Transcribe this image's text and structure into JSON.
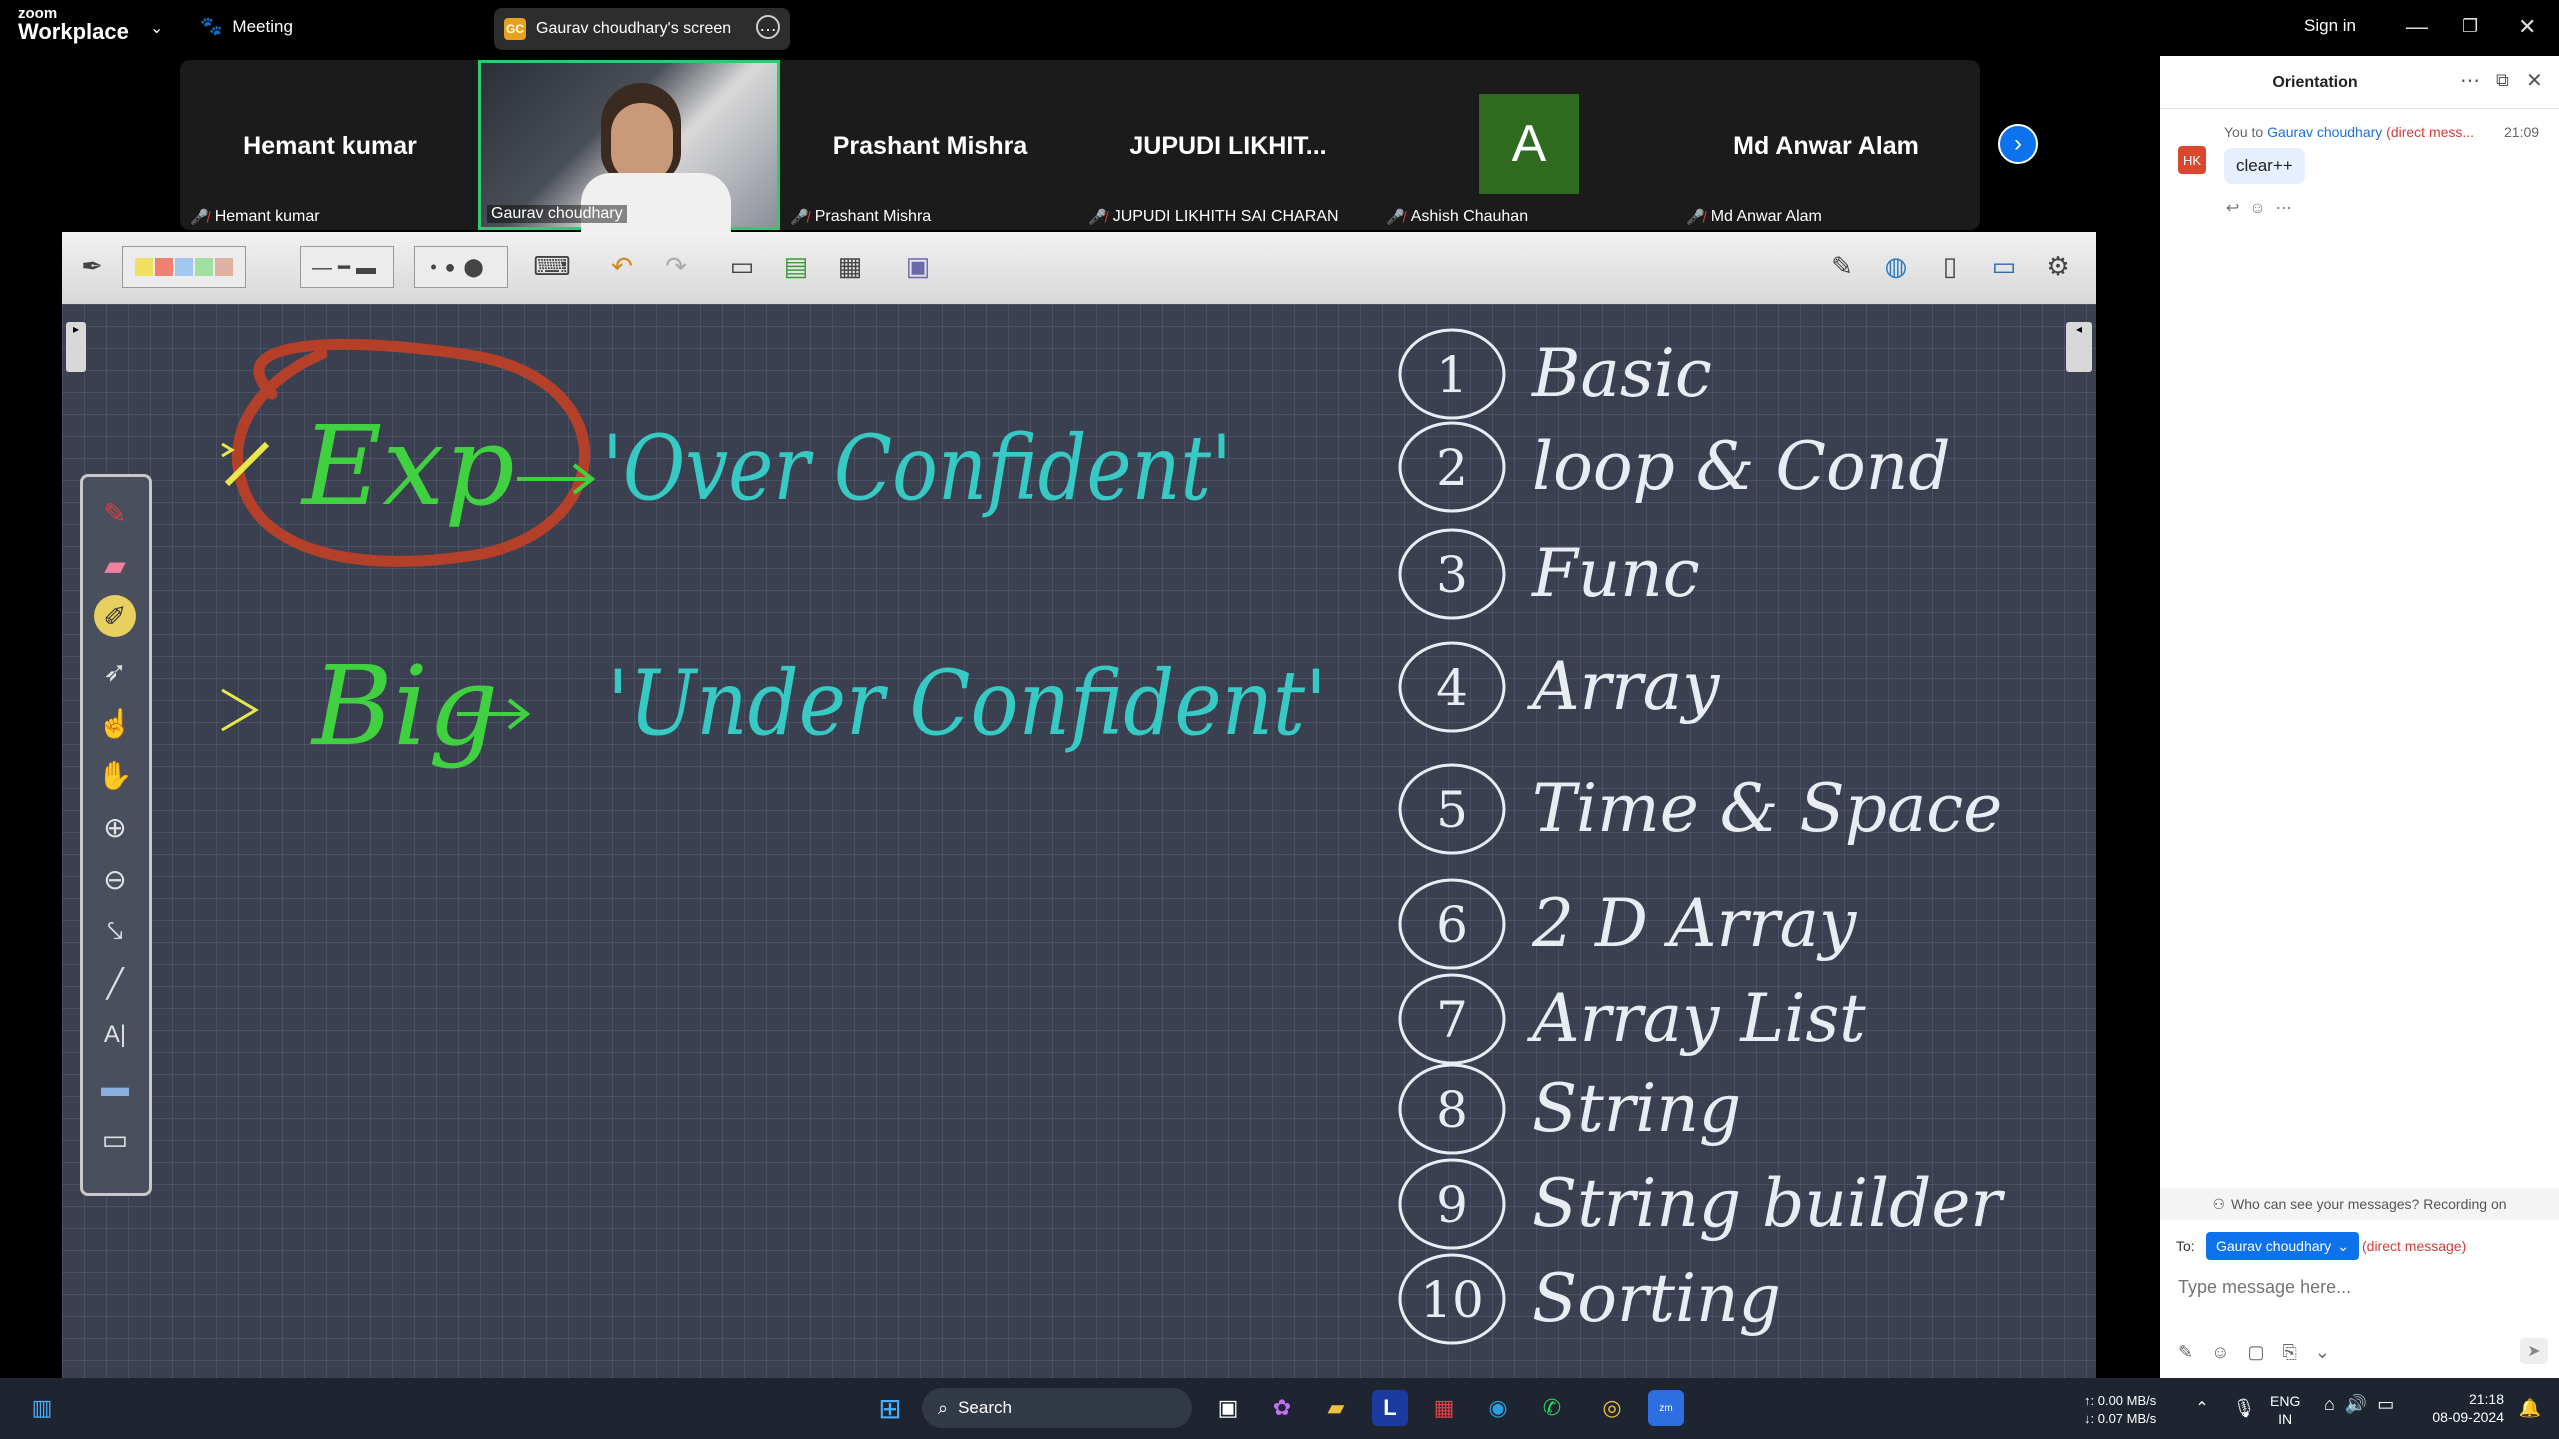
{
  "titlebar": {
    "logo_top": "zoom",
    "logo_bottom": "Workplace",
    "meeting_label": "Meeting",
    "share_badge": "GC",
    "share_label": "Gaurav choudhary's screen",
    "sign_in": "Sign in"
  },
  "gallery": {
    "tiles": [
      {
        "big": "Hemant kumar",
        "small": "Hemant kumar"
      },
      {
        "big": "",
        "small": "Gaurav choudhary"
      },
      {
        "big": "Prashant Mishra",
        "small": "Prashant Mishra"
      },
      {
        "big": "JUPUDI  LIKHIT...",
        "small": "JUPUDI LIKHITH SAI CHARAN"
      },
      {
        "big": "A",
        "small": "Ashish Chauhan"
      },
      {
        "big": "Md Anwar Alam",
        "small": "Md Anwar Alam"
      }
    ]
  },
  "board": {
    "left": [
      "Exp",
      "'Over Confident'",
      "Big",
      "'Under Confident'"
    ],
    "topics": [
      {
        "n": "1",
        "t": "Basic"
      },
      {
        "n": "2",
        "t": "loop & Cond"
      },
      {
        "n": "3",
        "t": "Func"
      },
      {
        "n": "4",
        "t": "Array"
      },
      {
        "n": "5",
        "t": "Time & Space"
      },
      {
        "n": "6",
        "t": "2 D Array"
      },
      {
        "n": "7",
        "t": "Array List"
      },
      {
        "n": "8",
        "t": "String"
      },
      {
        "n": "9",
        "t": "String builder"
      },
      {
        "n": "10",
        "t": "Sorting"
      }
    ],
    "colors": {
      "green": "#3fd13f",
      "cyan": "#37c9c3",
      "white": "#e9ecf2",
      "red": "#b5402a",
      "yellow": "#e8e84a"
    }
  },
  "chat": {
    "title": "Orientation",
    "msg_from": "You to",
    "msg_to": "Gaurav choudhary",
    "msg_direct": "(direct mess...",
    "msg_time": "21:09",
    "avatar": "HK",
    "msg_text": "clear++",
    "privacy": "Who can see your messages? Recording on",
    "to_label": "To:",
    "to_value": "Gaurav choudhary",
    "to_direct": "(direct message)",
    "placeholder": "Type message here..."
  },
  "taskbar": {
    "search": "Search",
    "net_up": "↑: 0.00 MB/s",
    "net_down": "↓: 0.07 MB/s",
    "lang1": "ENG",
    "lang2": "IN",
    "time": "21:18",
    "date": "08-09-2024"
  }
}
